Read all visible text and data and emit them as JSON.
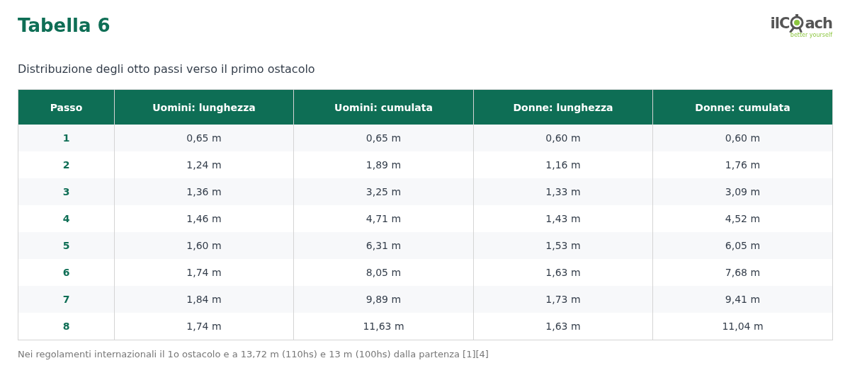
{
  "title": "Tabella 6",
  "logo": {
    "left": "ilC",
    "right": "ach",
    "tagline": "better yourself"
  },
  "subtitle": "Distribuzione degli otto passi verso il primo ostacolo",
  "table": {
    "columns": [
      "Passo",
      "Uomini: lunghezza",
      "Uomini: cumulata",
      "Donne: lunghezza",
      "Donne: cumulata"
    ],
    "rows": [
      [
        "1",
        "0,65 m",
        "0,65 m",
        "0,60 m",
        "0,60 m"
      ],
      [
        "2",
        "1,24 m",
        "1,89 m",
        "1,16 m",
        "1,76 m"
      ],
      [
        "3",
        "1,36 m",
        "3,25 m",
        "1,33 m",
        "3,09 m"
      ],
      [
        "4",
        "1,46 m",
        "4,71 m",
        "1,43 m",
        "4,52 m"
      ],
      [
        "5",
        "1,60 m",
        "6,31 m",
        "1,53 m",
        "6,05 m"
      ],
      [
        "6",
        "1,74 m",
        "8,05 m",
        "1,63 m",
        "7,68 m"
      ],
      [
        "7",
        "1,84 m",
        "9,89 m",
        "1,73 m",
        "9,41 m"
      ],
      [
        "8",
        "1,74 m",
        "11,63 m",
        "1,63 m",
        "11,04 m"
      ]
    ]
  },
  "footnote": "Nei regolamenti internazionali il 1o ostacolo e a 13,72 m (110hs) e 13 m (100hs) dalla partenza [1][4]"
}
